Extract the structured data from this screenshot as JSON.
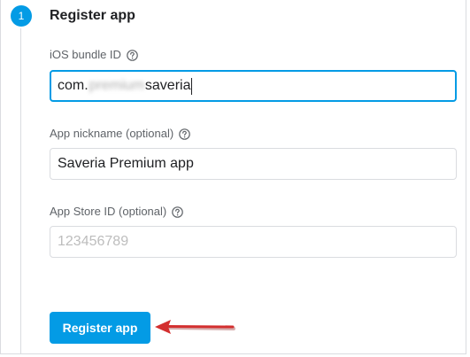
{
  "step": {
    "number": "1",
    "title": "Register app"
  },
  "fields": {
    "bundle_id": {
      "label": "iOS bundle ID",
      "value_prefix": "com.",
      "value_redacted": "premium",
      "value_suffix": "saveria"
    },
    "nickname": {
      "label": "App nickname (optional)",
      "value": "Saveria Premium app"
    },
    "app_store_id": {
      "label": "App Store ID (optional)",
      "placeholder": "123456789"
    }
  },
  "actions": {
    "register_label": "Register app"
  },
  "colors": {
    "accent": "#039be5",
    "annotation_arrow": "#d32f2f"
  },
  "icons": {
    "help": "help-circle-icon",
    "arrow": "annotation-arrow-icon"
  }
}
